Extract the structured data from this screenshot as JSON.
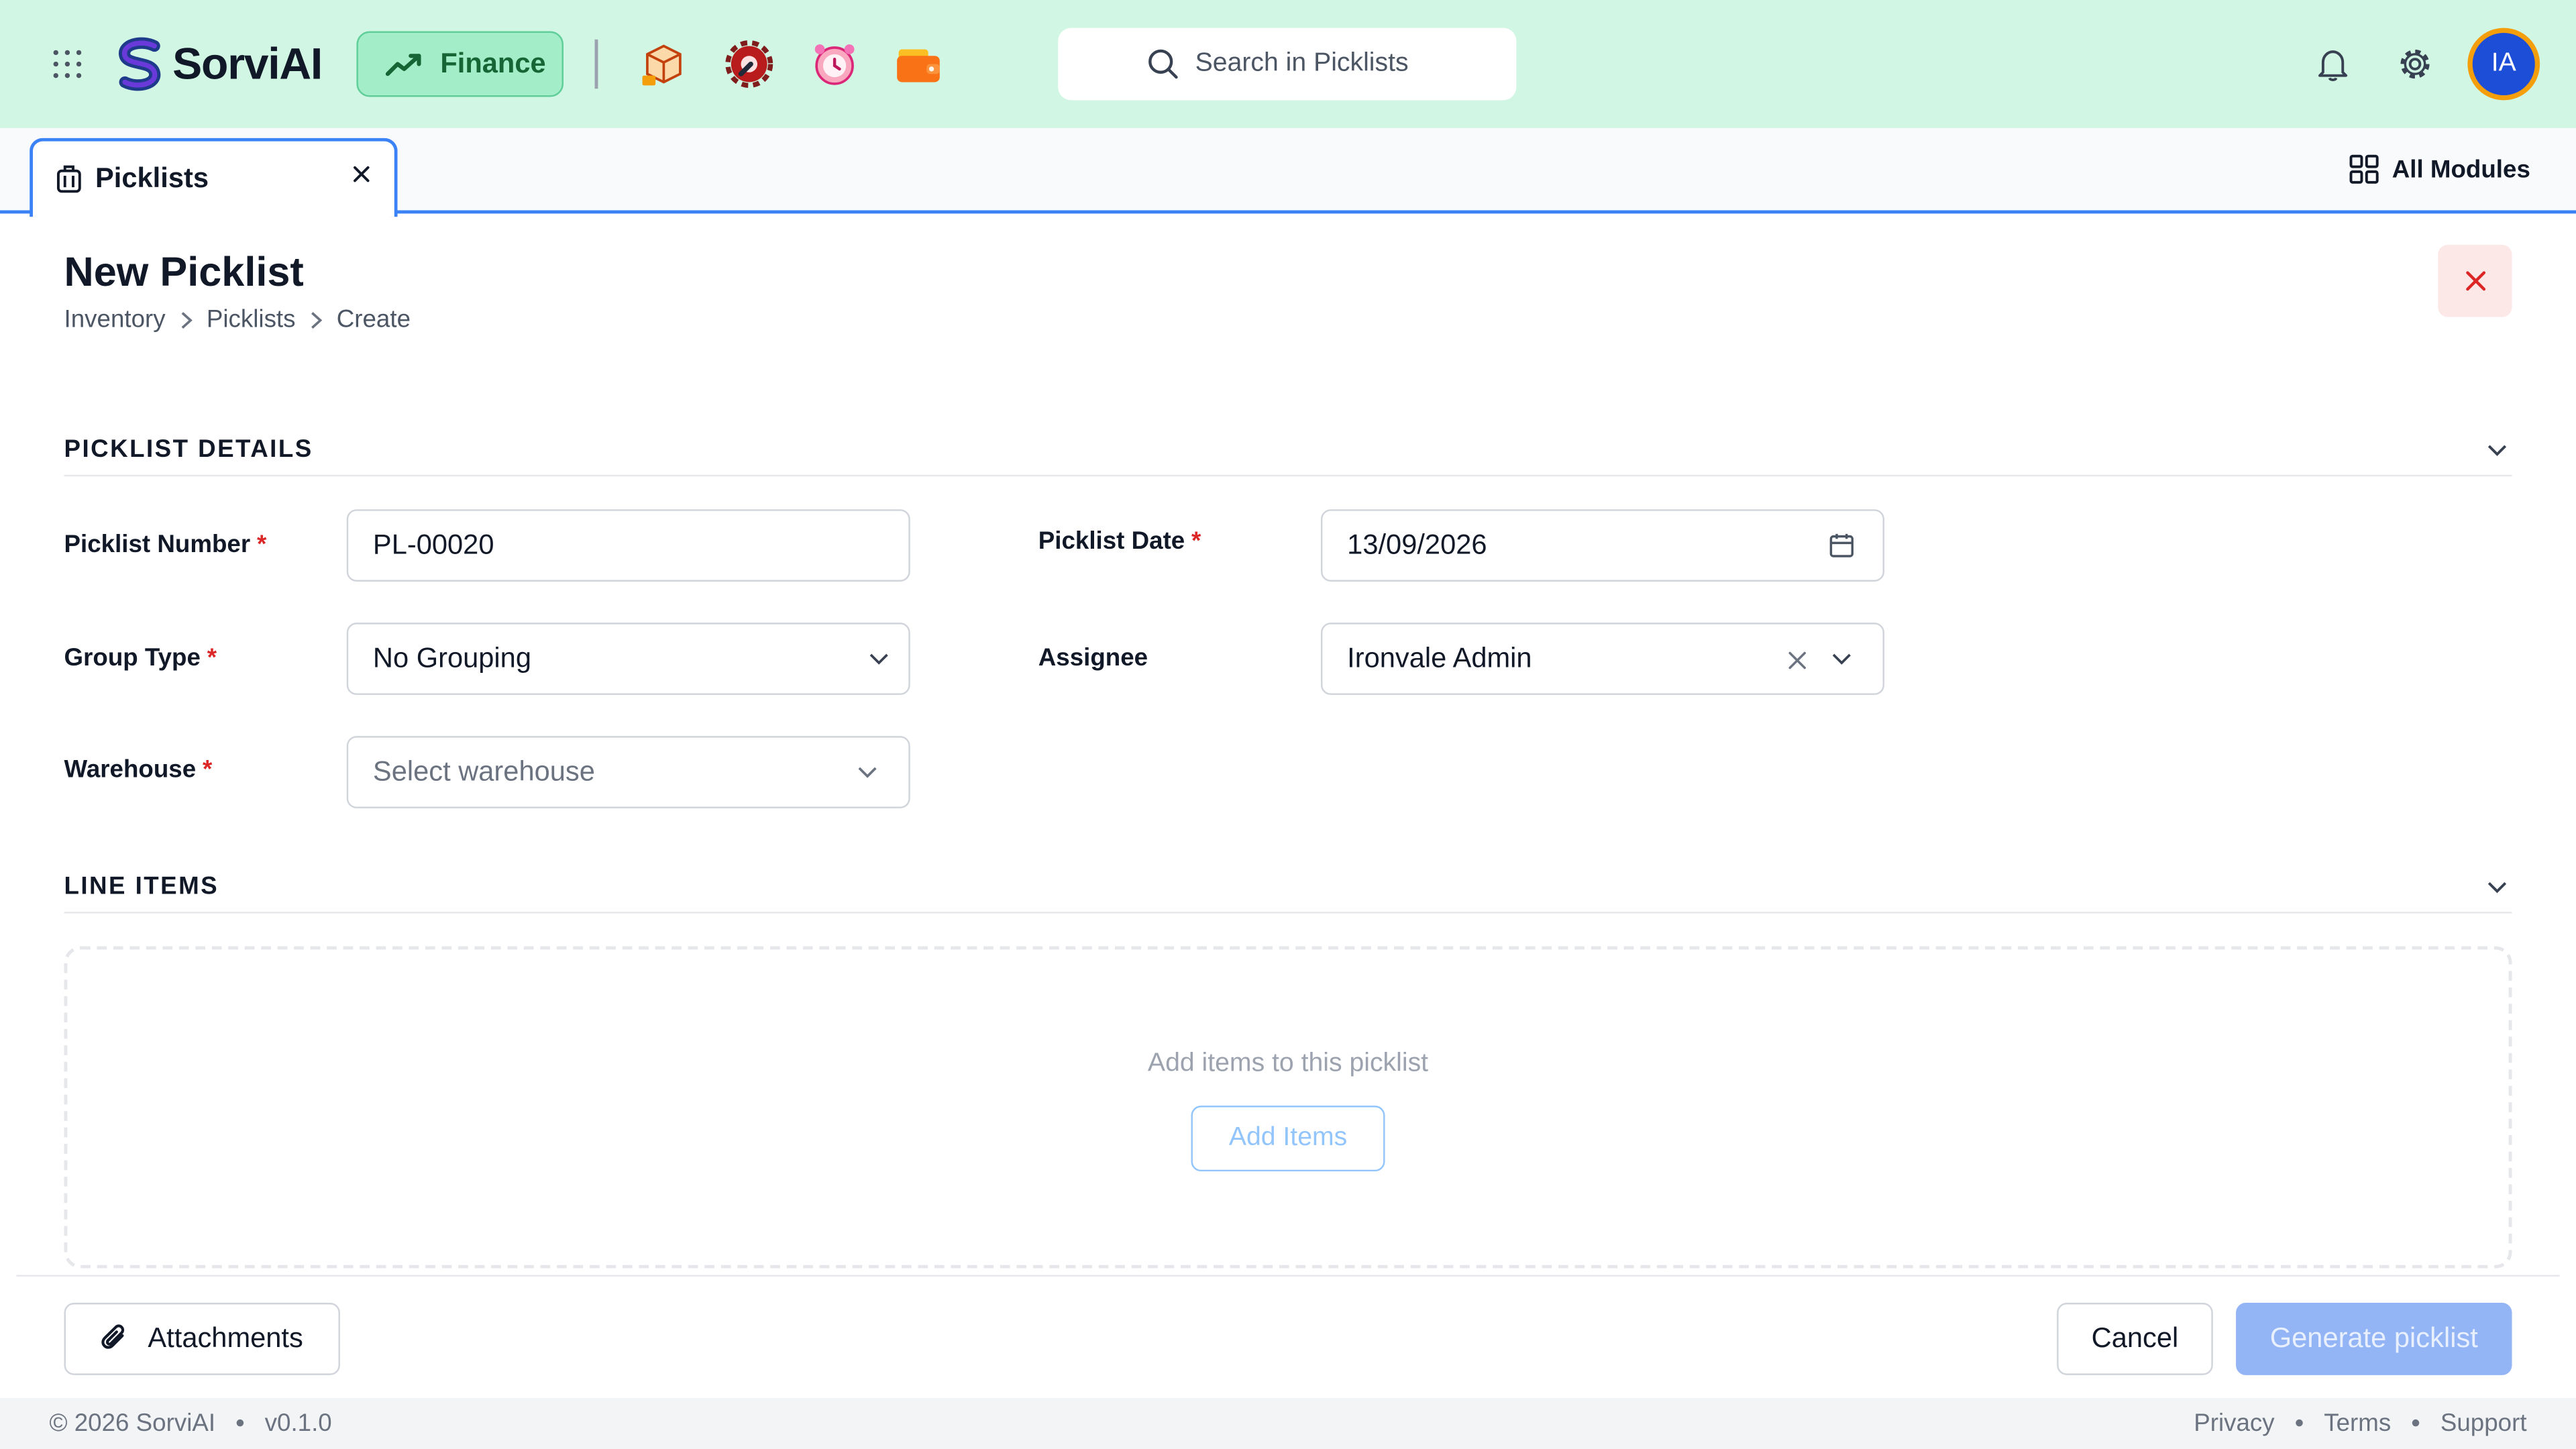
{
  "header": {
    "brand": "SorviAI",
    "module_button": "Finance",
    "app_icons": [
      "package-app-icon",
      "gear-wrench-app-icon",
      "alarm-clock-app-icon",
      "wallet-app-icon"
    ],
    "search_placeholder": "Search in Picklists",
    "avatar_initials": "IA",
    "colors": {
      "topbar": "#d1f7e4",
      "accent": "#3b82f6",
      "avatar": "#1d4ed8"
    }
  },
  "tabs": {
    "active": "Picklists",
    "all_modules": "All Modules"
  },
  "page": {
    "title": "New Picklist",
    "breadcrumb": [
      "Inventory",
      "Picklists",
      "Create"
    ]
  },
  "details": {
    "section_title": "PICKLIST DETAILS",
    "picklist_number_label": "Picklist Number",
    "picklist_number_value": "PL-00020",
    "picklist_date_label": "Picklist Date",
    "picklist_date_value": "13/09/2026",
    "group_type_label": "Group Type",
    "group_type_value": "No Grouping",
    "assignee_label": "Assignee",
    "assignee_value": "Ironvale Admin",
    "warehouse_label": "Warehouse",
    "warehouse_placeholder": "Select warehouse",
    "required_mark": "*"
  },
  "line_items": {
    "section_title": "LINE ITEMS",
    "empty_text": "Add items to this picklist",
    "add_button": "Add Items"
  },
  "footer": {
    "attachments": "Attachments",
    "cancel": "Cancel",
    "generate": "Generate picklist"
  },
  "statusbar": {
    "copyright": "© 2026 SorviAI",
    "version": "v0.1.0",
    "links": [
      "Privacy",
      "Terms",
      "Support"
    ]
  }
}
